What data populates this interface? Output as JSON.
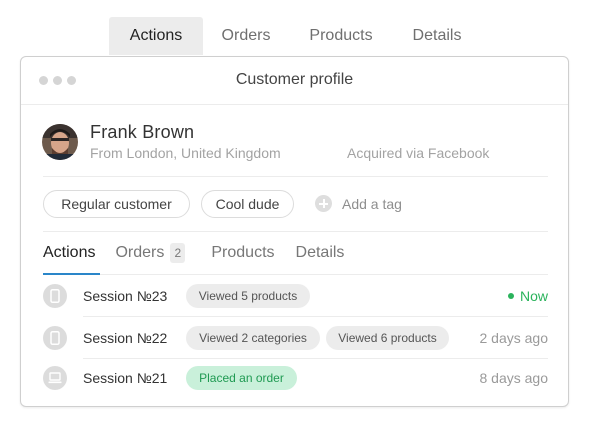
{
  "top_tabs": [
    {
      "label": "Actions",
      "active": true
    },
    {
      "label": "Orders",
      "active": false
    },
    {
      "label": "Products",
      "active": false
    },
    {
      "label": "Details",
      "active": false
    }
  ],
  "window": {
    "title": "Customer profile"
  },
  "profile": {
    "name": "Frank Brown",
    "location": "From London, United Kingdom",
    "acquired": "Acquired via Facebook"
  },
  "tags": {
    "items": [
      "Regular customer",
      "Cool dude"
    ],
    "add_label": "Add a tag"
  },
  "inner_tabs": {
    "actions": "Actions",
    "orders": "Orders",
    "orders_count": "2",
    "products": "Products",
    "details": "Details"
  },
  "sessions": [
    {
      "label": "Session №23",
      "device": "phone-icon",
      "chips": [
        "Viewed 5 products"
      ],
      "time": "Now",
      "time_color": "#2bb35c"
    },
    {
      "label": "Session №22",
      "device": "phone-icon",
      "chips": [
        "Viewed 2 categories",
        "Viewed 6 products"
      ],
      "time": "2 days ago"
    },
    {
      "label": "Session №21",
      "device": "laptop-icon",
      "chips": [
        "Placed an order"
      ],
      "chip_color": "#c9f0da",
      "time": "8 days ago"
    }
  ],
  "colors": {
    "accent": "#2a86c9",
    "success": "#2bb35c",
    "success_bg": "#c9f0da"
  }
}
